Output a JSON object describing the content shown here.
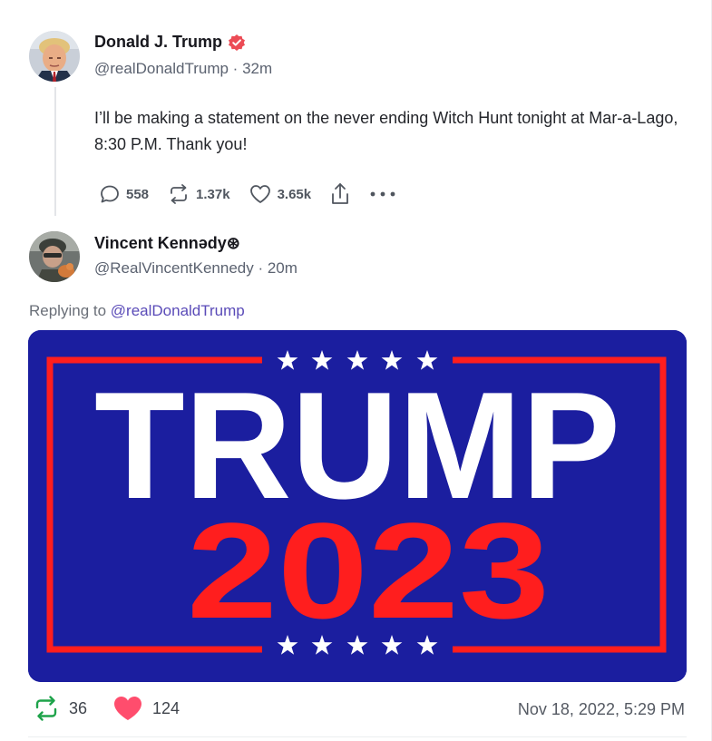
{
  "original_post": {
    "author_name": "Donald J. Trump",
    "handle_line": "@realDonaldTrump · 32m",
    "text": "I’ll be making a statement on the never ending Witch Hunt tonight at Mar-a-Lago, 8:30 P.M. Thank you!",
    "verified_badge_color": "#ec4b55",
    "actions": {
      "replies": "558",
      "retruths": "1.37k",
      "likes": "3.65k",
      "share_icon": "share-icon",
      "more_icon": "more-icon"
    }
  },
  "reply_post": {
    "author_name": "Vincent Kennәdy⊛",
    "handle_line": "@RealVincentKennedy · 20m",
    "replying_prefix": "Replying to ",
    "replying_mention": "@realDonaldTrump",
    "image": {
      "headline": "TRUMP",
      "year": "2023",
      "colors": {
        "background": "#1b1e9f",
        "border": "#ff1e1e",
        "headline": "#ffffff",
        "year": "#ff1e1e"
      }
    },
    "stats": {
      "retruths": "36",
      "likes": "124"
    },
    "timestamp": "Nov 18, 2022, 5:29 PM"
  },
  "colors": {
    "accent_link": "#5a4bb8",
    "retruth_green": "#1ea34a",
    "like_pink": "#ff4d6d"
  }
}
